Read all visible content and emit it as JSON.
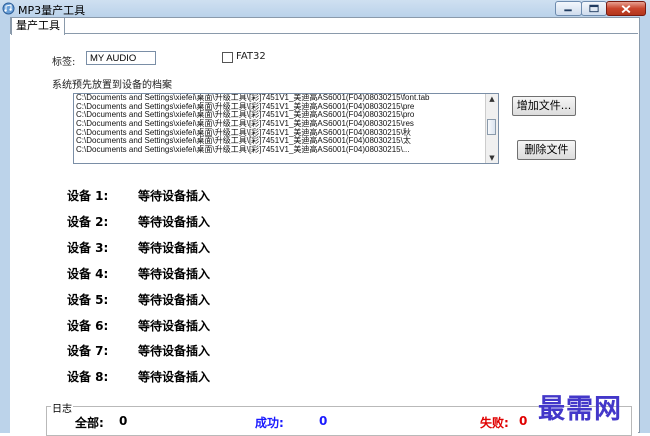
{
  "window": {
    "title": "MP3量产工具"
  },
  "tabs": [
    {
      "label": "量产工具"
    }
  ],
  "form": {
    "tag_label": "标签:",
    "tag_value": "MY AUDIO",
    "fat32_label": "FAT32",
    "fat32_checked": false,
    "files_caption": "系统预先放置到设备的档案"
  },
  "files": [
    "C:\\Documents and Settings\\xiefei\\桌面\\升级工具\\[彩]7451V1_美迪高AS6001(F04)08030215\\font.tab",
    "C:\\Documents and Settings\\xiefei\\桌面\\升级工具\\[彩]7451V1_美迪高AS6001(F04)08030215\\pre",
    "C:\\Documents and Settings\\xiefei\\桌面\\升级工具\\[彩]7451V1_美迪高AS6001(F04)08030215\\pro",
    "C:\\Documents and Settings\\xiefei\\桌面\\升级工具\\[彩]7451V1_美迪高AS6001(F04)08030215\\res",
    "C:\\Documents and Settings\\xiefei\\桌面\\升级工具\\[彩]7451V1_美迪高AS6001(F04)08030215\\秋",
    "C:\\Documents and Settings\\xiefei\\桌面\\升级工具\\[彩]7451V1_美迪高AS6001(F04)08030215\\太",
    "C:\\Documents and Settings\\xiefei\\桌面\\升级工具\\[彩]7451V1_美迪高AS6001(F04)08030215\\..."
  ],
  "buttons": {
    "add_file": "增加文件...",
    "delete_file": "删除文件"
  },
  "devices": [
    {
      "label": "设备 1:",
      "status": "等待设备插入"
    },
    {
      "label": "设备 2:",
      "status": "等待设备插入"
    },
    {
      "label": "设备 3:",
      "status": "等待设备插入"
    },
    {
      "label": "设备 4:",
      "status": "等待设备插入"
    },
    {
      "label": "设备 5:",
      "status": "等待设备插入"
    },
    {
      "label": "设备 6:",
      "status": "等待设备插入"
    },
    {
      "label": "设备 7:",
      "status": "等待设备插入"
    },
    {
      "label": "设备 8:",
      "status": "等待设备插入"
    }
  ],
  "log": {
    "legend": "日志",
    "total_label": "全部:",
    "total_value": "0",
    "success_label": "成功:",
    "success_value": "0",
    "fail_label": "失败:",
    "fail_value": "0"
  },
  "colors": {
    "success": "#1a1aff",
    "fail": "#e00000",
    "watermark": "#4337c9"
  },
  "watermark": "最需网"
}
